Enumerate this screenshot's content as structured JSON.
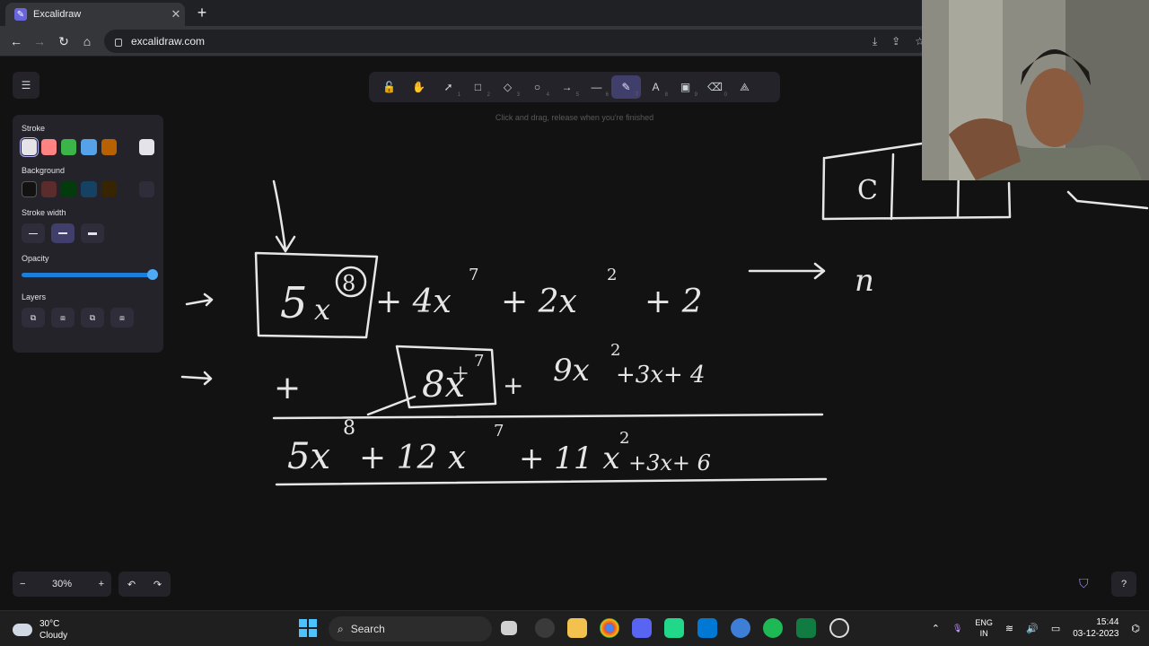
{
  "browser": {
    "tab_title": "Excalidraw",
    "url": "excalidraw.com"
  },
  "toolbar": {
    "hint": "Click and drag, release when you're finished",
    "tools": [
      {
        "icon": "lock-icon",
        "glyph": "🔓",
        "num": ""
      },
      {
        "icon": "hand-icon",
        "glyph": "✋",
        "num": ""
      },
      {
        "icon": "selection-icon",
        "glyph": "➚",
        "num": "1"
      },
      {
        "icon": "rectangle-icon",
        "glyph": "□",
        "num": "2"
      },
      {
        "icon": "diamond-icon",
        "glyph": "◇",
        "num": "3"
      },
      {
        "icon": "ellipse-icon",
        "glyph": "○",
        "num": "4"
      },
      {
        "icon": "arrow-icon",
        "glyph": "→",
        "num": "5"
      },
      {
        "icon": "line-icon",
        "glyph": "—",
        "num": "6"
      },
      {
        "icon": "pencil-icon",
        "glyph": "✎",
        "num": "7"
      },
      {
        "icon": "text-icon",
        "glyph": "A",
        "num": "8"
      },
      {
        "icon": "image-icon",
        "glyph": "▣",
        "num": "9"
      },
      {
        "icon": "eraser-icon",
        "glyph": "⌫",
        "num": "0"
      },
      {
        "icon": "shapes-library-icon",
        "glyph": "⟁",
        "num": ""
      }
    ]
  },
  "panel": {
    "stroke_label": "Stroke",
    "background_label": "Background",
    "stroke_width_label": "Stroke width",
    "opacity_label": "Opacity",
    "layers_label": "Layers",
    "opacity_value": 1.0,
    "stroke_colors": [
      "#e3e3e8",
      "#ff8383",
      "#3bb44a",
      "#56a2e8",
      "#b76100"
    ],
    "stroke_current": "#e3e3e8",
    "background_colors": [
      "#121212",
      "#5b2c2c",
      "#043b0c",
      "#154163",
      "#362500"
    ]
  },
  "zoom": {
    "level": "30%",
    "minus": "−",
    "plus": "+"
  },
  "taskbar": {
    "temperature": "30°C",
    "condition": "Cloudy",
    "search_label": "Search",
    "lang_1": "ENG",
    "lang_2": "IN",
    "time": "15:44",
    "date": "03-12-2023"
  }
}
